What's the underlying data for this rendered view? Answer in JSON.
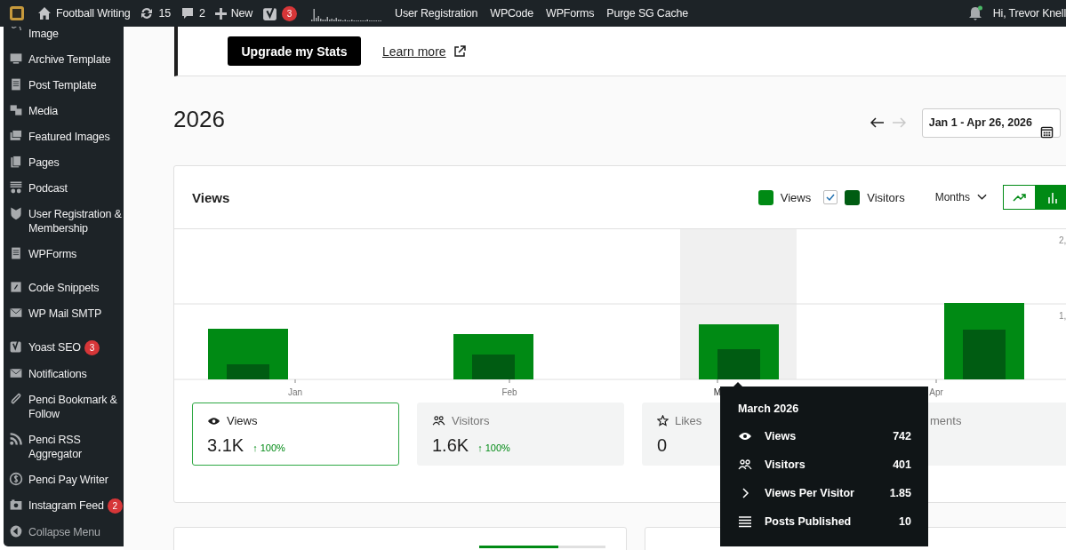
{
  "admin_bar": {
    "site_name": "Football Writing",
    "updates": "15",
    "comments": "2",
    "new_label": "New",
    "seo_badge": "3",
    "links": [
      "User Registration",
      "WPCode",
      "WPForms",
      "Purge SG Cache"
    ],
    "notification_dot": true,
    "greeting": "Hi, Trevor Knell"
  },
  "sidebar": {
    "groups": [
      {
        "items": [
          {
            "label": "Image",
            "kind": "item"
          },
          {
            "label": "Archive Template",
            "kind": "item"
          },
          {
            "label": "Post Template",
            "kind": "item"
          },
          {
            "label": "Media",
            "kind": "item"
          },
          {
            "label": "Featured Images",
            "kind": "item"
          },
          {
            "label": "Pages",
            "kind": "item"
          },
          {
            "label": "Podcast",
            "kind": "item"
          },
          {
            "label": "User Registration & Membership",
            "kind": "item"
          },
          {
            "label": "WPForms",
            "kind": "item"
          }
        ]
      },
      {
        "items": [
          {
            "label": "Code Snippets",
            "kind": "item"
          },
          {
            "label": "WP Mail SMTP",
            "kind": "item"
          }
        ]
      },
      {
        "items": [
          {
            "label": "Yoast SEO",
            "badge": "3",
            "kind": "item"
          },
          {
            "label": "Notifications",
            "kind": "item"
          },
          {
            "label": "Penci Bookmark & Follow",
            "kind": "item"
          },
          {
            "label": "Penci RSS Aggregator",
            "kind": "item"
          },
          {
            "label": "Penci Pay Writer",
            "kind": "item"
          },
          {
            "label": "Instagram Feed",
            "badge": "2",
            "kind": "item"
          },
          {
            "label": "Collapse Menu",
            "kind": "collapse"
          }
        ]
      }
    ]
  },
  "banner": {
    "button": "Upgrade my Stats",
    "link": "Learn more"
  },
  "header": {
    "year": "2026",
    "date_range": "Jan 1 - Apr 26, 2026",
    "next_disabled": true
  },
  "chart_card": {
    "title": "Views",
    "legend": [
      {
        "label": "Views",
        "color": "#008a14",
        "kind": "plain"
      },
      {
        "label": "Visitors",
        "color": "#005c12",
        "kind": "checkbox",
        "checked": true
      }
    ],
    "period": "Months",
    "view_toggle": [
      {
        "selected": false
      },
      {
        "selected": true
      }
    ],
    "tick_labels": [
      "2,",
      "1,"
    ],
    "months": [
      {
        "label": "Jan",
        "highlighted": false
      },
      {
        "label": "Feb",
        "highlighted": false
      },
      {
        "label": "M",
        "highlighted": true
      },
      {
        "label": "Apr",
        "highlighted": false
      }
    ],
    "stats": [
      {
        "label": "Views",
        "value": "3.1K",
        "change": "↑ 100%",
        "selected": true
      },
      {
        "label": "Visitors",
        "value": "1.6K",
        "change": "↑ 100%",
        "selected": false
      },
      {
        "label": "Likes",
        "value": "0",
        "selected": false
      },
      {
        "label": "ments",
        "selected": false
      }
    ]
  },
  "lower_panel": {
    "level": 0.63
  },
  "tooltip": {
    "title": "March 2026",
    "rows": [
      {
        "label": "Views",
        "value": "742"
      },
      {
        "label": "Visitors",
        "value": "401"
      },
      {
        "label": "Views Per Visitor",
        "value": "1.85"
      },
      {
        "label": "Posts Published",
        "value": "10"
      }
    ]
  }
}
